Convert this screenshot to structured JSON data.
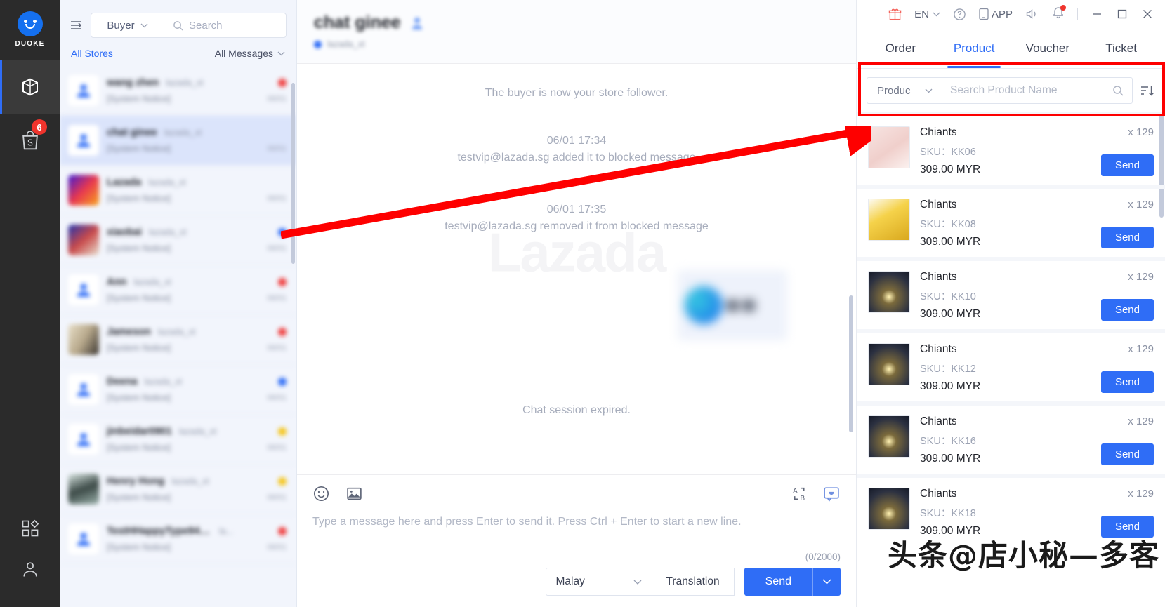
{
  "rail": {
    "brand": "DUOKE",
    "logo_icon": "smiley-face-icon",
    "items": [
      {
        "name": "package-icon",
        "badge": ""
      },
      {
        "name": "shopee-bag-icon",
        "badge": "6"
      }
    ],
    "bottom_items": [
      {
        "name": "apps-grid-icon"
      },
      {
        "name": "user-account-icon"
      }
    ]
  },
  "conversations": {
    "collapse_icon": "collapse-panel-icon",
    "role_filter": "Buyer",
    "search_placeholder": "Search",
    "search_icon": "search-icon",
    "all_stores": "All Stores",
    "all_messages": "All Messages",
    "items": [
      {
        "name": "wang zhen",
        "store": "lazada_xt",
        "preview": "[System Notice]",
        "time": "06/01",
        "dot": "red",
        "avatar": "person",
        "selected": false
      },
      {
        "name": "chat ginee",
        "store": "lazada_xt",
        "preview": "[System Notice]",
        "time": "06/01",
        "dot": "",
        "avatar": "person",
        "selected": true
      },
      {
        "name": "Lazada",
        "store": "lazada_xt",
        "preview": "[System Notice]",
        "time": "06/01",
        "dot": "",
        "avatar": "img-a",
        "selected": false
      },
      {
        "name": "xiaobai",
        "store": "lazada_xt",
        "preview": "[System Notice]",
        "time": "06/01",
        "dot": "blue",
        "avatar": "img-b",
        "selected": false
      },
      {
        "name": "Ann",
        "store": "lazada_xt",
        "preview": "[System Notice]",
        "time": "06/01",
        "dot": "red",
        "avatar": "person",
        "selected": false
      },
      {
        "name": "Jameson",
        "store": "lazada_xt",
        "preview": "[System Notice]",
        "time": "06/01",
        "dot": "red",
        "avatar": "img-c",
        "selected": false
      },
      {
        "name": "Deena",
        "store": "lazada_xt",
        "preview": "[System Notice]",
        "time": "06/01",
        "dot": "blue",
        "avatar": "person",
        "selected": false
      },
      {
        "name": "jinbeidar0901",
        "store": "lazada_xt",
        "preview": "[System Notice]",
        "time": "06/01",
        "dot": "yellow",
        "avatar": "person",
        "selected": false
      },
      {
        "name": "Henry Hong",
        "store": "lazada_xt",
        "preview": "[System Notice]",
        "time": "06/01",
        "dot": "yellow",
        "avatar": "img-d",
        "selected": false
      },
      {
        "name": "TestHHappyType9403687...",
        "store": "la...",
        "preview": "[System Notice]",
        "time": "06/01",
        "dot": "red",
        "avatar": "person",
        "selected": false
      }
    ]
  },
  "chat": {
    "title": "chat ginee",
    "title_icon": "buyer-profile-icon",
    "store_dot_color": "#2f6df6",
    "store": "lazada_xt",
    "watermark": "Lazada",
    "messages": [
      {
        "type": "system",
        "text": "The buyer is now your store follower."
      },
      {
        "type": "system",
        "time": "06/01 17:34",
        "text": "testvip@lazada.sg added it to blocked message"
      },
      {
        "type": "system",
        "time": "06/01 17:35",
        "text": "testvip@lazada.sg removed it from blocked message"
      },
      {
        "type": "image",
        "text": ""
      },
      {
        "type": "system",
        "text": "Chat session expired."
      }
    ],
    "composer": {
      "emoji_icon": "emoji-icon",
      "image_icon": "image-attachment-icon",
      "translate_icon": "translate-ab-icon",
      "quickreply_icon": "quick-reply-icon",
      "placeholder": "Type a message here and press Enter to send it. Press Ctrl + Enter to start a new line.",
      "counter": "(0/2000)",
      "language": "Malay",
      "translation_label": "Translation",
      "send_label": "Send",
      "send_dropdown_icon": "chevron-down-icon"
    }
  },
  "titlebar": {
    "gift_icon": "gift-icon",
    "language": "EN",
    "lang_chevron_icon": "chevron-down-icon",
    "help_icon": "help-circle-icon",
    "app_icon": "mobile-app-icon",
    "app_label": "APP",
    "sound_icon": "speaker-icon",
    "bell_icon": "notification-bell-icon",
    "minimize_icon": "minimize-icon",
    "maximize_icon": "maximize-icon",
    "close_icon": "close-icon"
  },
  "right_panel": {
    "tabs": [
      {
        "label": "Order",
        "active": false
      },
      {
        "label": "Product",
        "active": true
      },
      {
        "label": "Voucher",
        "active": false
      },
      {
        "label": "Ticket",
        "active": false
      }
    ],
    "filter_label": "Produc",
    "filter_chevron_icon": "chevron-down-icon",
    "search_placeholder": "Search Product Name",
    "search_icon": "search-icon",
    "sort_icon": "sort-list-icon",
    "send_label": "Send",
    "products": [
      {
        "name": "Chiants",
        "sku_label": "SKU：",
        "sku": "KK06",
        "price": "309.00 MYR",
        "qty": "x 129",
        "thumb": "th-pink"
      },
      {
        "name": "Chiants",
        "sku_label": "SKU：",
        "sku": "KK08",
        "price": "309.00 MYR",
        "qty": "x 129",
        "thumb": "th-yellow"
      },
      {
        "name": "Chiants",
        "sku_label": "SKU：",
        "sku": "KK10",
        "price": "309.00 MYR",
        "qty": "x 129",
        "thumb": "th-night"
      },
      {
        "name": "Chiants",
        "sku_label": "SKU：",
        "sku": "KK12",
        "price": "309.00 MYR",
        "qty": "x 129",
        "thumb": "th-night"
      },
      {
        "name": "Chiants",
        "sku_label": "SKU：",
        "sku": "KK16",
        "price": "309.00 MYR",
        "qty": "x 129",
        "thumb": "th-night"
      },
      {
        "name": "Chiants",
        "sku_label": "SKU：",
        "sku": "KK18",
        "price": "309.00 MYR",
        "qty": "x 129",
        "thumb": "th-night"
      }
    ]
  },
  "annotations": {
    "highlight_color": "#fe0000",
    "watermark": "头条@店小秘—多客"
  }
}
